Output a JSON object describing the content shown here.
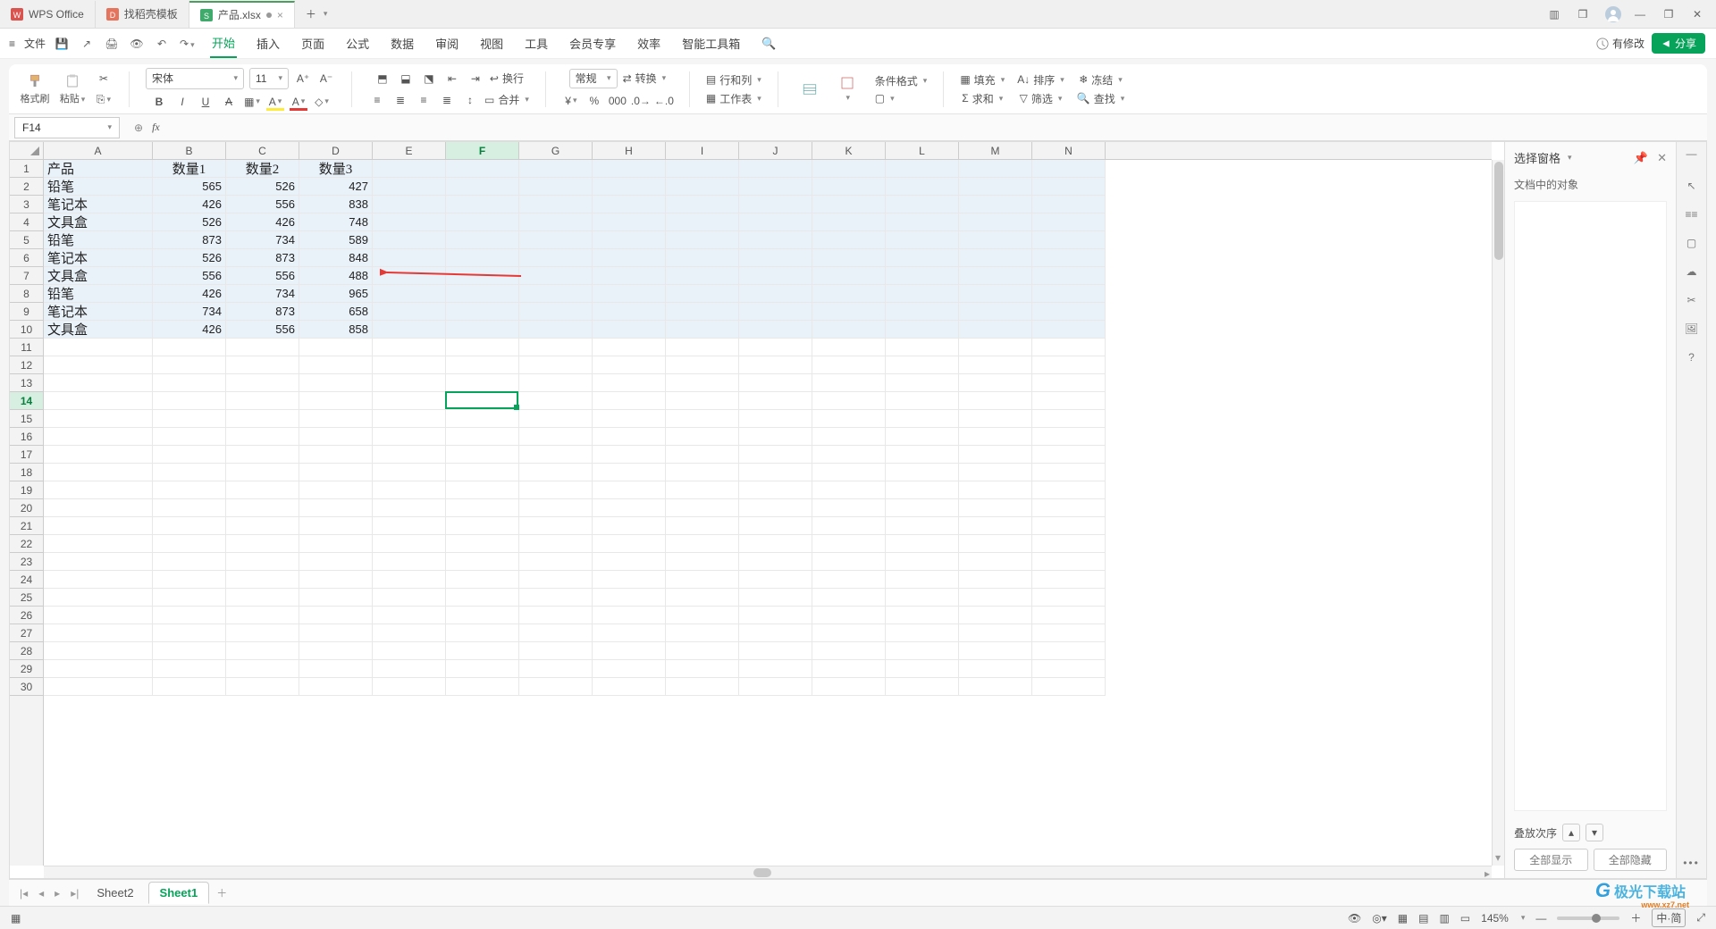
{
  "title_tabs": [
    {
      "icon": "wps",
      "label": "WPS Office"
    },
    {
      "icon": "template",
      "label": "找稻壳模板"
    },
    {
      "icon": "sheet",
      "label": "产品.xlsx",
      "active": true,
      "modified": true
    }
  ],
  "menu_file": "文件",
  "menu_tabs": [
    "开始",
    "插入",
    "页面",
    "公式",
    "数据",
    "审阅",
    "视图",
    "工具",
    "会员专享",
    "效率",
    "智能工具箱"
  ],
  "menu_active": "开始",
  "mod_label": "有修改",
  "share_label": "分享",
  "ribbon": {
    "format_painter": "格式刷",
    "paste": "粘贴",
    "font_name": "宋体",
    "font_size": "11",
    "wrap": "换行",
    "merge": "合并",
    "number_format": "常规",
    "convert": "转换",
    "rowcol": "行和列",
    "worksheet": "工作表",
    "cond_fmt": "条件格式",
    "fill": "填充",
    "sort": "排序",
    "freeze": "冻结",
    "sum": "求和",
    "filter": "筛选",
    "find": "查找"
  },
  "name_box": "F14",
  "fx_label": "fx",
  "columns": [
    "A",
    "B",
    "C",
    "D",
    "E",
    "F",
    "G",
    "H",
    "I",
    "J",
    "K",
    "L",
    "M",
    "N"
  ],
  "rows": 30,
  "active": {
    "col": "F",
    "row": 14
  },
  "grid": {
    "headers": [
      "产品",
      "数量1",
      "数量2",
      "数量3"
    ],
    "rows": [
      [
        "铅笔",
        565,
        526,
        427
      ],
      [
        "笔记本",
        426,
        556,
        838
      ],
      [
        "文具盒",
        526,
        426,
        748
      ],
      [
        "铅笔",
        873,
        734,
        589
      ],
      [
        "笔记本",
        526,
        873,
        848
      ],
      [
        "文具盒",
        556,
        556,
        488
      ],
      [
        "铅笔",
        426,
        734,
        965
      ],
      [
        "笔记本",
        734,
        873,
        658
      ],
      [
        "文具盒",
        426,
        556,
        858
      ]
    ]
  },
  "panel": {
    "title": "选择窗格",
    "objects_label": "文档中的对象",
    "stack_label": "叠放次序",
    "show_all": "全部显示",
    "hide_all": "全部隐藏"
  },
  "sheets": {
    "list": [
      "Sheet2",
      "Sheet1"
    ],
    "active": "Sheet1"
  },
  "status": {
    "zoom": "145%",
    "ime": "中·简"
  }
}
